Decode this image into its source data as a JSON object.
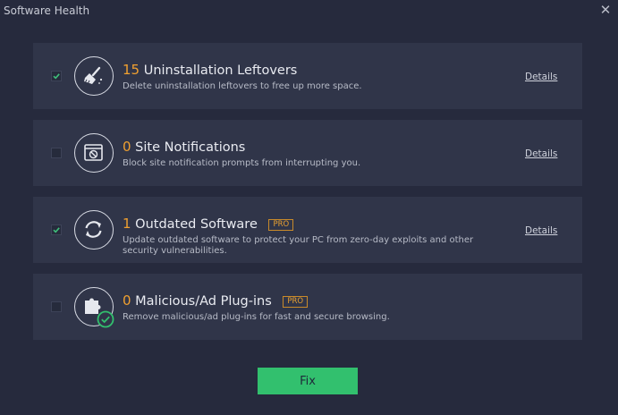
{
  "window": {
    "title": "Software Health",
    "close_glyph": "✕"
  },
  "items": [
    {
      "count": "15",
      "label": "Uninstallation Leftovers",
      "description": "Delete uninstallation leftovers to free up more space.",
      "details": "Details",
      "checked": true,
      "icon": "broom-icon"
    },
    {
      "count": "0",
      "label": "Site Notifications",
      "description": "Block site notification prompts from interrupting you.",
      "details": "Details",
      "checked": false,
      "icon": "blocked-notification-icon"
    },
    {
      "count": "1",
      "label": "Outdated Software",
      "badge": "PRO",
      "description": "Update outdated software to protect your PC from zero-day exploits and other security vulnerabilities.",
      "details": "Details",
      "checked": true,
      "icon": "refresh-icon"
    },
    {
      "count": "0",
      "label": "Malicious/Ad Plug-ins",
      "badge": "PRO",
      "description": "Remove malicious/ad plug-ins for fast and secure browsing.",
      "checked": false,
      "icon": "puzzle-shield-icon"
    }
  ],
  "fix_button": "Fix",
  "colors": {
    "background": "#262a3d",
    "card": "#303549",
    "accent_orange": "#f0a030",
    "accent_green": "#32c06e"
  }
}
